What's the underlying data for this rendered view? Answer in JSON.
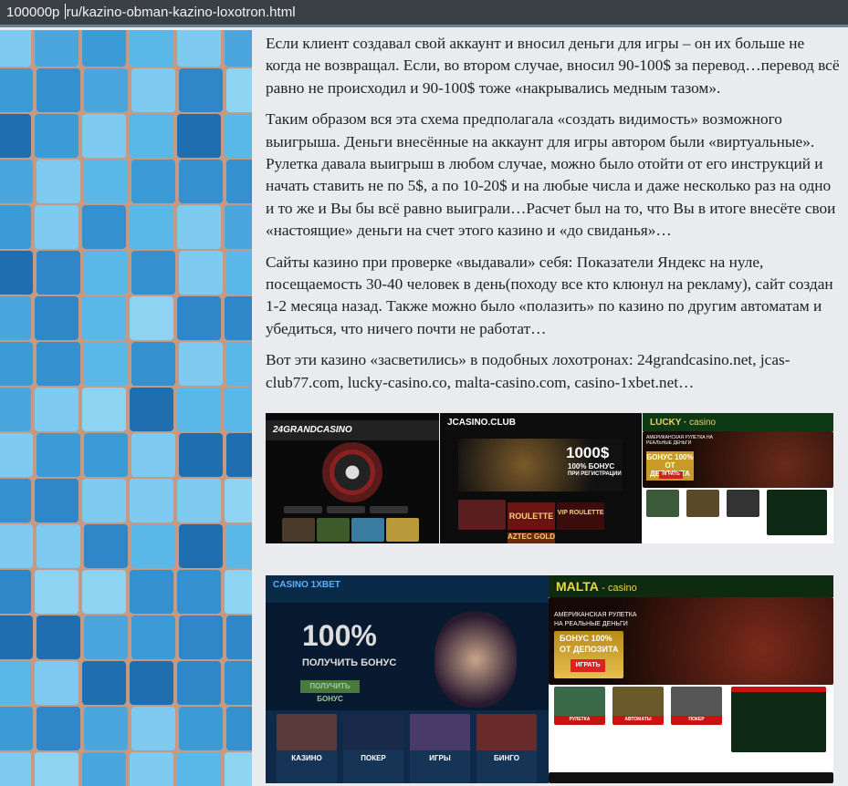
{
  "address_bar": {
    "url_prefix": "100000р",
    "url_rest": "ru/kazino-obman-kazino-loxotron.html"
  },
  "article": {
    "paragraphs": [
      "Если клиент создавал свой аккаунт и вносил деньги для игры – он их больше не когда не возвращал. Если, во втором случае, вносил 90-100$ за перевод…перевод всё равно не происходил и 90-100$ тоже «накрывались медным тазом».",
      "Таким образом вся эта схема предполагала «создать видимость» возможного выигрыша. Деньги внесённые на аккаунт для игры автором были «виртуальные». Рулетка давала выигрыш в любом случае, можно было отойти от его инструкций и начать ставить не по 5$, а по 10-20$ и на любые числа и даже несколько раз на одно и то же и Вы бы всё равно выиграли…Расчет был на то, что Вы в итоге внесёте свои «настоящие» деньги на счет этого казино и «до свиданья»…",
      "Сайты казино при проверке «выдавали» себя: Показатели Яндекс на нуле, посещаемость 30-40 человек в день(походу все кто клюнул на рекламу), сайт создан 1-2 месяца назад. Также можно было «полазить» по казино по другим автоматам и убедиться, что ничего почти не работат…",
      "Вот эти казино «засветились» в подобных лохотронах: 24grandcasino.net, jcas-club77.com, lucky-casino.co, malta-casino.com, casino-1xbet.net…"
    ]
  },
  "screenshots": {
    "grand": {
      "logo": "24GRANDCASINO"
    },
    "jcasino": {
      "logo": "JCASINO.CLUB",
      "amount": "1000$",
      "bonus": "100% БОНУС",
      "sub": "ПРИ РЕГИСТРАЦИИ",
      "game1": "ROULETTE",
      "game2": "VIP ROULETTE",
      "game3": "AZTEC GOLD"
    },
    "lucky": {
      "logo": "LUCKY",
      "logo2": "casino",
      "headline": "АМЕРИКАНСКАЯ РУЛЕТКА НА РЕАЛЬНЫЕ ДЕНЬГИ",
      "bonus": "БОНУС 100% ОТ ДЕПОЗИТА",
      "play": "ИГРАТЬ"
    },
    "xbet": {
      "logo": "CASINO 1XBET",
      "percent": "100%",
      "get_bonus": "ПОЛУЧИТЬ БОНУС",
      "cats": [
        "КАЗИНО",
        "ПОКЕР",
        "ИГРЫ",
        "БИНГО"
      ]
    },
    "malta": {
      "logo": "MALTA",
      "logo2": "- casino",
      "headline1": "АМЕРИКАНСКАЯ РУЛЕТКА",
      "headline2": "НА РЕАЛЬНЫЕ ДЕНЬГИ",
      "bonus1": "БОНУС 100%",
      "bonus2": "ОТ ДЕПОЗИТА",
      "play": "ИГРАТЬ",
      "cats": [
        "РУЛЕТКА",
        "АВТОМАТЫ",
        "ПОКЕР"
      ]
    }
  },
  "colors": {
    "urlbar": "#3b4046",
    "page_bg": "#e9ebee",
    "text": "#222222"
  }
}
